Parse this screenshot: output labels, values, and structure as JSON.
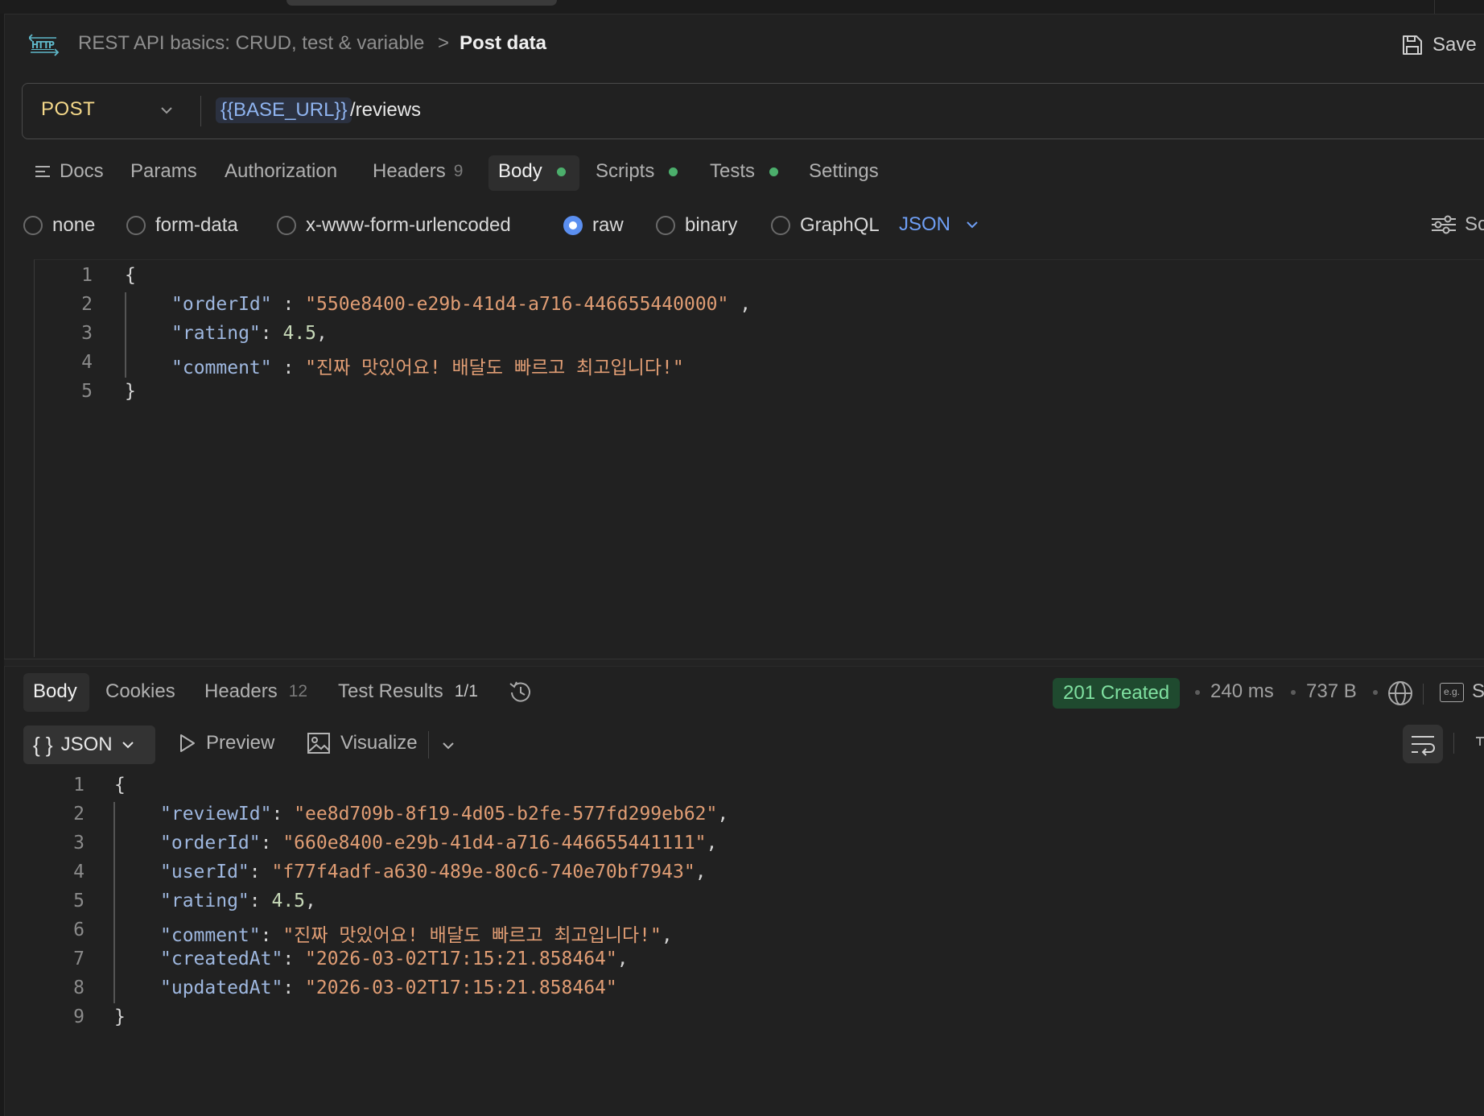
{
  "header": {
    "breadcrumb_collection": "REST API basics: CRUD, test & variable",
    "breadcrumb_separator": ">",
    "breadcrumb_current": "Post data",
    "save_label": "Save",
    "http_icon_label": "HTTP"
  },
  "url_bar": {
    "method": "POST",
    "url_variable": "{{BASE_URL}}",
    "url_path": "/reviews"
  },
  "request_tabs": [
    {
      "label": "Docs"
    },
    {
      "label": "Params"
    },
    {
      "label": "Authorization"
    },
    {
      "label": "Headers",
      "count": "9"
    },
    {
      "label": "Body",
      "active": true,
      "dot": true
    },
    {
      "label": "Scripts",
      "dot": true
    },
    {
      "label": "Tests",
      "dot": true
    },
    {
      "label": "Settings"
    }
  ],
  "body_types": [
    {
      "label": "none",
      "selected": false
    },
    {
      "label": "form-data",
      "selected": false
    },
    {
      "label": "x-www-form-urlencoded",
      "selected": false
    },
    {
      "label": "raw",
      "selected": true
    },
    {
      "label": "binary",
      "selected": false
    },
    {
      "label": "GraphQL",
      "selected": false
    }
  ],
  "raw_language": "JSON",
  "schema_button_partial": "Sc",
  "request_body": {
    "line_numbers": [
      "1",
      "2",
      "3",
      "4",
      "5"
    ],
    "open_brace": "{",
    "close_brace": "}",
    "fields": [
      {
        "key": "\"orderId\"",
        "sep": " : ",
        "value": "\"550e8400-e29b-41d4-a716-446655440000\"",
        "trail": " ,",
        "type": "string"
      },
      {
        "key": "\"rating\"",
        "sep": ": ",
        "value": "4.5",
        "trail": ",",
        "type": "number"
      },
      {
        "key": "\"comment\"",
        "sep": " : ",
        "value": "\"진짜 맛있어요! 배달도 빠르고 최고입니다!\"",
        "trail": "",
        "type": "string"
      }
    ]
  },
  "response_tabs": [
    {
      "label": "Body",
      "active": true
    },
    {
      "label": "Cookies"
    },
    {
      "label": "Headers",
      "count": "12"
    },
    {
      "label": "Test Results",
      "count": "1/1"
    }
  ],
  "response_meta": {
    "status": "201 Created",
    "time": "240 ms",
    "size": "737 B",
    "save_partial": "S",
    "example_icon_label": "e.g."
  },
  "response_toolbar": {
    "format": "JSON",
    "format_icon": "{ }",
    "preview_label": "Preview",
    "visualize_label": "Visualize"
  },
  "response_body": {
    "line_numbers": [
      "1",
      "2",
      "3",
      "4",
      "5",
      "6",
      "7",
      "8",
      "9"
    ],
    "open_brace": "{",
    "close_brace": "}",
    "fields": [
      {
        "key": "\"reviewId\"",
        "value": "\"ee8d709b-8f19-4d05-b2fe-577fd299eb62\"",
        "trail": ",",
        "type": "string"
      },
      {
        "key": "\"orderId\"",
        "value": "\"660e8400-e29b-41d4-a716-446655441111\"",
        "trail": ",",
        "type": "string"
      },
      {
        "key": "\"userId\"",
        "value": "\"f77f4adf-a630-489e-80c6-740e70bf7943\"",
        "trail": ",",
        "type": "string"
      },
      {
        "key": "\"rating\"",
        "value": "4.5",
        "trail": ",",
        "type": "number"
      },
      {
        "key": "\"comment\"",
        "value": "\"진짜 맛있어요! 배달도 빠르고 최고입니다!\"",
        "trail": ",",
        "type": "string"
      },
      {
        "key": "\"createdAt\"",
        "value": "\"2026-03-02T17:15:21.858464\"",
        "trail": ",",
        "type": "string"
      },
      {
        "key": "\"updatedAt\"",
        "value": "\"2026-03-02T17:15:21.858464\"",
        "trail": "",
        "type": "string"
      }
    ]
  },
  "colors": {
    "background": "#212121",
    "method": "#f5d98a",
    "accent_blue": "#5b8ff0",
    "status_green": "#7fe0a0",
    "dot_green": "#4caf6c",
    "json_key": "#9fb8e0",
    "json_string": "#e09d74",
    "json_number": "#c7d9b8"
  }
}
